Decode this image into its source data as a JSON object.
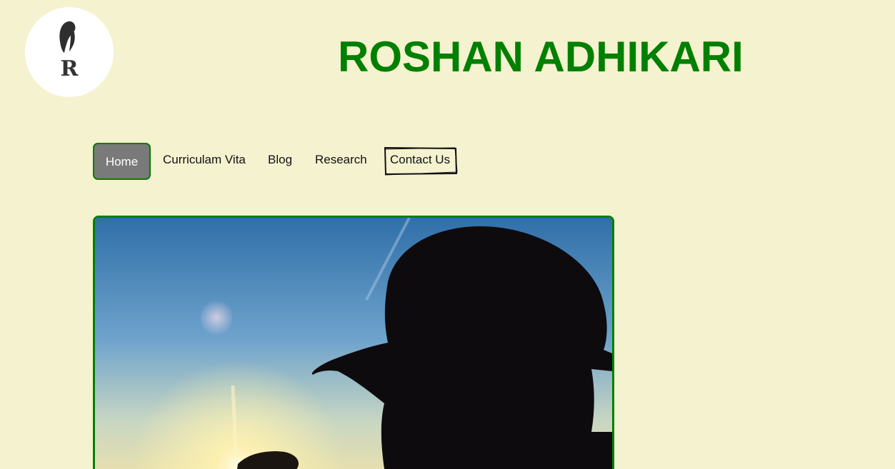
{
  "header": {
    "logo_letter": "R",
    "title": "ROSHAN ADHIKARI"
  },
  "nav": {
    "items": [
      {
        "label": "Home",
        "active": true
      },
      {
        "label": "Curriculam Vita"
      },
      {
        "label": "Blog"
      },
      {
        "label": "Research"
      },
      {
        "label": "Contact Us"
      }
    ]
  },
  "colors": {
    "background": "#f5f2d0",
    "accent": "#008000",
    "active_tab": "#7a7a7a"
  },
  "hero": {
    "image": "silhouette-photo"
  }
}
